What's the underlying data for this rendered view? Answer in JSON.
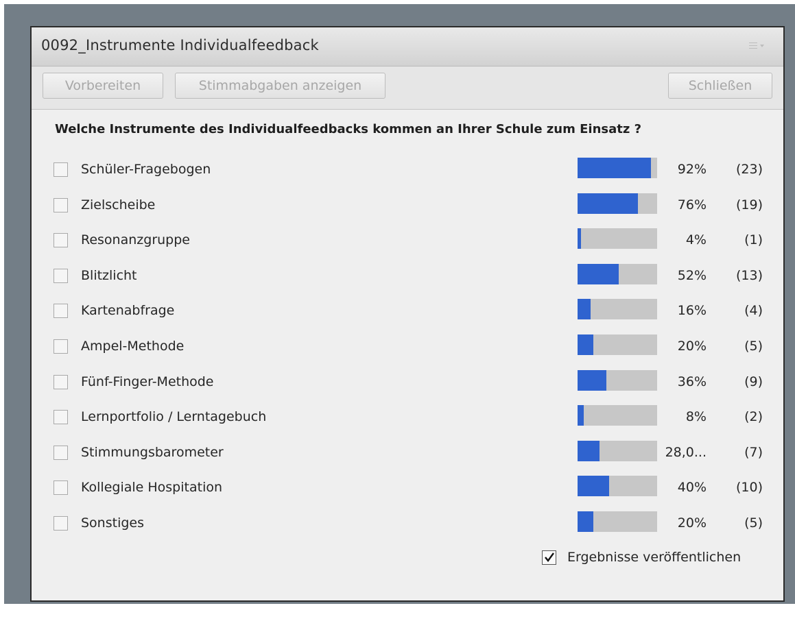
{
  "window": {
    "title": "0092_Instrumente Individualfeedback",
    "menu_icon": "menu-lines-icon"
  },
  "toolbar": {
    "prepare_label": "Vorbereiten",
    "show_votes_label": "Stimmabgaben anzeigen",
    "close_label": "Schließen"
  },
  "poll": {
    "question": "Welche Instrumente des Individualfeedbacks kommen an Ihrer Schule zum Einsatz ?",
    "options": [
      {
        "label": "Schüler-Fragebogen",
        "percent_text": "92%",
        "count_text": "(23)",
        "fraction": 0.92,
        "checked": false
      },
      {
        "label": "Zielscheibe",
        "percent_text": "76%",
        "count_text": "(19)",
        "fraction": 0.76,
        "checked": false
      },
      {
        "label": "Resonanzgruppe",
        "percent_text": "4%",
        "count_text": "(1)",
        "fraction": 0.04,
        "checked": false
      },
      {
        "label": "Blitzlicht",
        "percent_text": "52%",
        "count_text": "(13)",
        "fraction": 0.52,
        "checked": false
      },
      {
        "label": "Kartenabfrage",
        "percent_text": "16%",
        "count_text": "(4)",
        "fraction": 0.16,
        "checked": false
      },
      {
        "label": "Ampel-Methode",
        "percent_text": "20%",
        "count_text": "(5)",
        "fraction": 0.2,
        "checked": false
      },
      {
        "label": "Fünf-Finger-Methode",
        "percent_text": "36%",
        "count_text": "(9)",
        "fraction": 0.36,
        "checked": false
      },
      {
        "label": "Lernportfolio / Lerntagebuch",
        "percent_text": "8%",
        "count_text": "(2)",
        "fraction": 0.08,
        "checked": false
      },
      {
        "label": "Stimmungsbarometer",
        "percent_text": "28,0...",
        "count_text": "(7)",
        "fraction": 0.28,
        "checked": false
      },
      {
        "label": "Kollegiale Hospitation",
        "percent_text": "40%",
        "count_text": "(10)",
        "fraction": 0.4,
        "checked": false
      },
      {
        "label": "Sonstiges",
        "percent_text": "20%",
        "count_text": "(5)",
        "fraction": 0.2,
        "checked": false
      }
    ]
  },
  "publish": {
    "label": "Ergebnisse veröffentlichen",
    "checked": true
  },
  "colors": {
    "bar_fill": "#2f63cf",
    "bar_track": "#c7c7c7",
    "frame": "#737e87"
  }
}
